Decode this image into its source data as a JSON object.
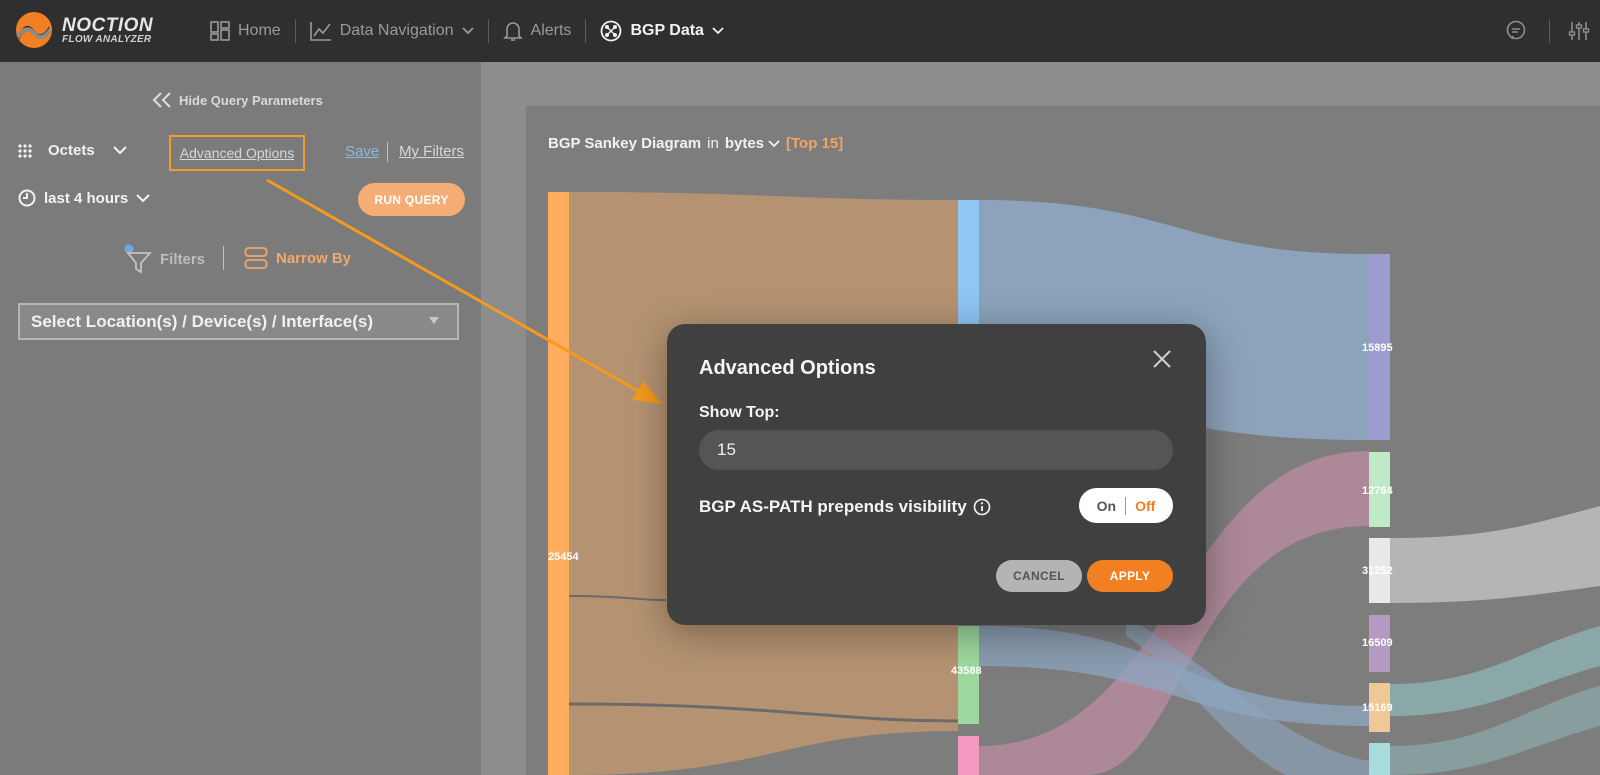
{
  "app": {
    "logo_main": "NOCTION",
    "logo_sub": "FLOW ANALYZER"
  },
  "nav": {
    "home": "Home",
    "data_navigation": "Data Navigation",
    "alerts": "Alerts",
    "bgp_data": "BGP Data"
  },
  "query": {
    "hide_label": "Hide Query Parameters",
    "metric": "Octets",
    "advanced_options": "Advanced Options",
    "save": "Save",
    "my_filters": "My Filters",
    "time_range": "last 4 hours",
    "run_query": "RUN QUERY",
    "filters": "Filters",
    "narrow_by": "Narrow By",
    "location_select": "Select Location(s) / Device(s) / Interface(s)"
  },
  "chart": {
    "title_prefix": "BGP Sankey Diagram",
    "title_in": "in",
    "unit": "bytes",
    "top_label": "[Top 15]",
    "node_labels": [
      "25454",
      "43588",
      "15895",
      "12764",
      "31252",
      "16509",
      "15169"
    ]
  },
  "modal": {
    "title": "Advanced Options",
    "show_top_label": "Show Top:",
    "show_top_value": "15",
    "prepend_label": "BGP AS-PATH prepends visibility",
    "toggle_on": "On",
    "toggle_off": "Off",
    "toggle_state": "Off",
    "cancel": "CANCEL",
    "apply": "APPLY"
  },
  "colors": {
    "accent": "#f27f22",
    "topbar": "#2f2f2f",
    "modal_bg": "#404040"
  }
}
